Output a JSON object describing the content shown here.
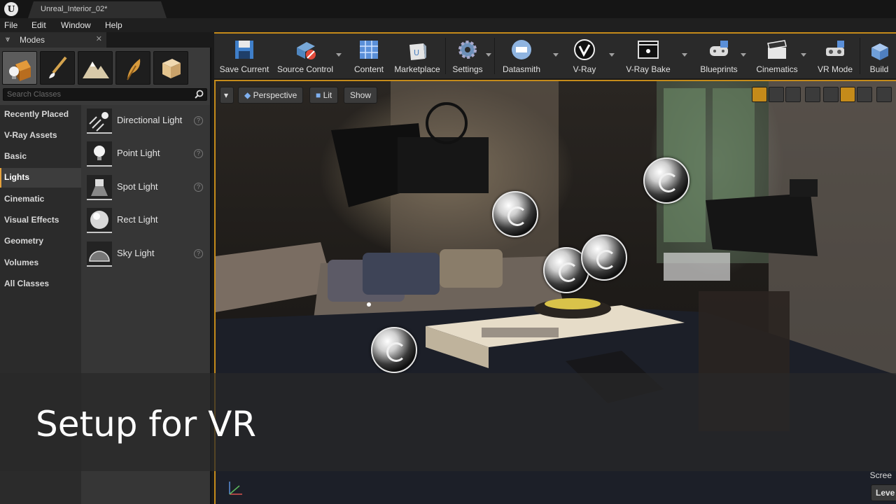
{
  "window": {
    "tab_title": "Unreal_Interior_02*"
  },
  "menu": [
    "File",
    "Edit",
    "Window",
    "Help"
  ],
  "modes": {
    "tab_label": "Modes",
    "search_placeholder": "Search Classes",
    "categories": [
      "Recently Placed",
      "V-Ray Assets",
      "Basic",
      "Lights",
      "Cinematic",
      "Visual Effects",
      "Geometry",
      "Volumes",
      "All Classes"
    ],
    "active_category": "Lights",
    "items": [
      {
        "label": "Directional Light",
        "icon": "directional-light-icon"
      },
      {
        "label": "Point Light",
        "icon": "point-light-icon"
      },
      {
        "label": "Spot Light",
        "icon": "spot-light-icon"
      },
      {
        "label": "Rect Light",
        "icon": "rect-light-icon"
      },
      {
        "label": "Sky Light",
        "icon": "sky-light-icon"
      }
    ]
  },
  "toolbar": {
    "buttons": [
      {
        "label": "Save Current",
        "icon": "floppy-disk-icon"
      },
      {
        "label": "Source Control",
        "icon": "source-control-icon"
      },
      {
        "label": "Content",
        "icon": "content-grid-icon"
      },
      {
        "label": "Marketplace",
        "icon": "marketplace-bag-icon"
      },
      {
        "label": "Settings",
        "icon": "settings-gear-icon"
      },
      {
        "label": "Datasmith",
        "icon": "datasmith-icon"
      },
      {
        "label": "V-Ray",
        "icon": "vray-logo-icon"
      },
      {
        "label": "V-Ray Bake",
        "icon": "vray-bake-icon"
      },
      {
        "label": "Blueprints",
        "icon": "gamepad-icon"
      },
      {
        "label": "Cinematics",
        "icon": "clapperboard-icon"
      },
      {
        "label": "VR Mode",
        "icon": "vr-headset-icon"
      },
      {
        "label": "Build",
        "icon": "build-blocks-icon"
      }
    ]
  },
  "viewport": {
    "perspective_label": "Perspective",
    "lit_label": "Lit",
    "show_label": "Show",
    "screen_label": "Scree",
    "level_label": "Leve"
  },
  "caption": "Setup for VR",
  "colors": {
    "accent": "#c58b1a",
    "active_category_marker": "#e6a23c"
  }
}
